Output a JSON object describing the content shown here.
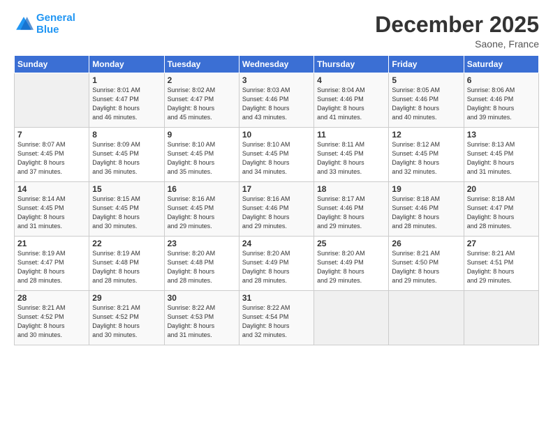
{
  "logo": {
    "line1": "General",
    "line2": "Blue"
  },
  "title": "December 2025",
  "subtitle": "Saone, France",
  "days_header": [
    "Sunday",
    "Monday",
    "Tuesday",
    "Wednesday",
    "Thursday",
    "Friday",
    "Saturday"
  ],
  "weeks": [
    [
      {
        "num": "",
        "info": ""
      },
      {
        "num": "1",
        "info": "Sunrise: 8:01 AM\nSunset: 4:47 PM\nDaylight: 8 hours\nand 46 minutes."
      },
      {
        "num": "2",
        "info": "Sunrise: 8:02 AM\nSunset: 4:47 PM\nDaylight: 8 hours\nand 45 minutes."
      },
      {
        "num": "3",
        "info": "Sunrise: 8:03 AM\nSunset: 4:46 PM\nDaylight: 8 hours\nand 43 minutes."
      },
      {
        "num": "4",
        "info": "Sunrise: 8:04 AM\nSunset: 4:46 PM\nDaylight: 8 hours\nand 41 minutes."
      },
      {
        "num": "5",
        "info": "Sunrise: 8:05 AM\nSunset: 4:46 PM\nDaylight: 8 hours\nand 40 minutes."
      },
      {
        "num": "6",
        "info": "Sunrise: 8:06 AM\nSunset: 4:46 PM\nDaylight: 8 hours\nand 39 minutes."
      }
    ],
    [
      {
        "num": "7",
        "info": "Sunrise: 8:07 AM\nSunset: 4:45 PM\nDaylight: 8 hours\nand 37 minutes."
      },
      {
        "num": "8",
        "info": "Sunrise: 8:09 AM\nSunset: 4:45 PM\nDaylight: 8 hours\nand 36 minutes."
      },
      {
        "num": "9",
        "info": "Sunrise: 8:10 AM\nSunset: 4:45 PM\nDaylight: 8 hours\nand 35 minutes."
      },
      {
        "num": "10",
        "info": "Sunrise: 8:10 AM\nSunset: 4:45 PM\nDaylight: 8 hours\nand 34 minutes."
      },
      {
        "num": "11",
        "info": "Sunrise: 8:11 AM\nSunset: 4:45 PM\nDaylight: 8 hours\nand 33 minutes."
      },
      {
        "num": "12",
        "info": "Sunrise: 8:12 AM\nSunset: 4:45 PM\nDaylight: 8 hours\nand 32 minutes."
      },
      {
        "num": "13",
        "info": "Sunrise: 8:13 AM\nSunset: 4:45 PM\nDaylight: 8 hours\nand 31 minutes."
      }
    ],
    [
      {
        "num": "14",
        "info": "Sunrise: 8:14 AM\nSunset: 4:45 PM\nDaylight: 8 hours\nand 31 minutes."
      },
      {
        "num": "15",
        "info": "Sunrise: 8:15 AM\nSunset: 4:45 PM\nDaylight: 8 hours\nand 30 minutes."
      },
      {
        "num": "16",
        "info": "Sunrise: 8:16 AM\nSunset: 4:45 PM\nDaylight: 8 hours\nand 29 minutes."
      },
      {
        "num": "17",
        "info": "Sunrise: 8:16 AM\nSunset: 4:46 PM\nDaylight: 8 hours\nand 29 minutes."
      },
      {
        "num": "18",
        "info": "Sunrise: 8:17 AM\nSunset: 4:46 PM\nDaylight: 8 hours\nand 29 minutes."
      },
      {
        "num": "19",
        "info": "Sunrise: 8:18 AM\nSunset: 4:46 PM\nDaylight: 8 hours\nand 28 minutes."
      },
      {
        "num": "20",
        "info": "Sunrise: 8:18 AM\nSunset: 4:47 PM\nDaylight: 8 hours\nand 28 minutes."
      }
    ],
    [
      {
        "num": "21",
        "info": "Sunrise: 8:19 AM\nSunset: 4:47 PM\nDaylight: 8 hours\nand 28 minutes."
      },
      {
        "num": "22",
        "info": "Sunrise: 8:19 AM\nSunset: 4:48 PM\nDaylight: 8 hours\nand 28 minutes."
      },
      {
        "num": "23",
        "info": "Sunrise: 8:20 AM\nSunset: 4:48 PM\nDaylight: 8 hours\nand 28 minutes."
      },
      {
        "num": "24",
        "info": "Sunrise: 8:20 AM\nSunset: 4:49 PM\nDaylight: 8 hours\nand 28 minutes."
      },
      {
        "num": "25",
        "info": "Sunrise: 8:20 AM\nSunset: 4:49 PM\nDaylight: 8 hours\nand 29 minutes."
      },
      {
        "num": "26",
        "info": "Sunrise: 8:21 AM\nSunset: 4:50 PM\nDaylight: 8 hours\nand 29 minutes."
      },
      {
        "num": "27",
        "info": "Sunrise: 8:21 AM\nSunset: 4:51 PM\nDaylight: 8 hours\nand 29 minutes."
      }
    ],
    [
      {
        "num": "28",
        "info": "Sunrise: 8:21 AM\nSunset: 4:52 PM\nDaylight: 8 hours\nand 30 minutes."
      },
      {
        "num": "29",
        "info": "Sunrise: 8:21 AM\nSunset: 4:52 PM\nDaylight: 8 hours\nand 30 minutes."
      },
      {
        "num": "30",
        "info": "Sunrise: 8:22 AM\nSunset: 4:53 PM\nDaylight: 8 hours\nand 31 minutes."
      },
      {
        "num": "31",
        "info": "Sunrise: 8:22 AM\nSunset: 4:54 PM\nDaylight: 8 hours\nand 32 minutes."
      },
      {
        "num": "",
        "info": ""
      },
      {
        "num": "",
        "info": ""
      },
      {
        "num": "",
        "info": ""
      }
    ]
  ]
}
